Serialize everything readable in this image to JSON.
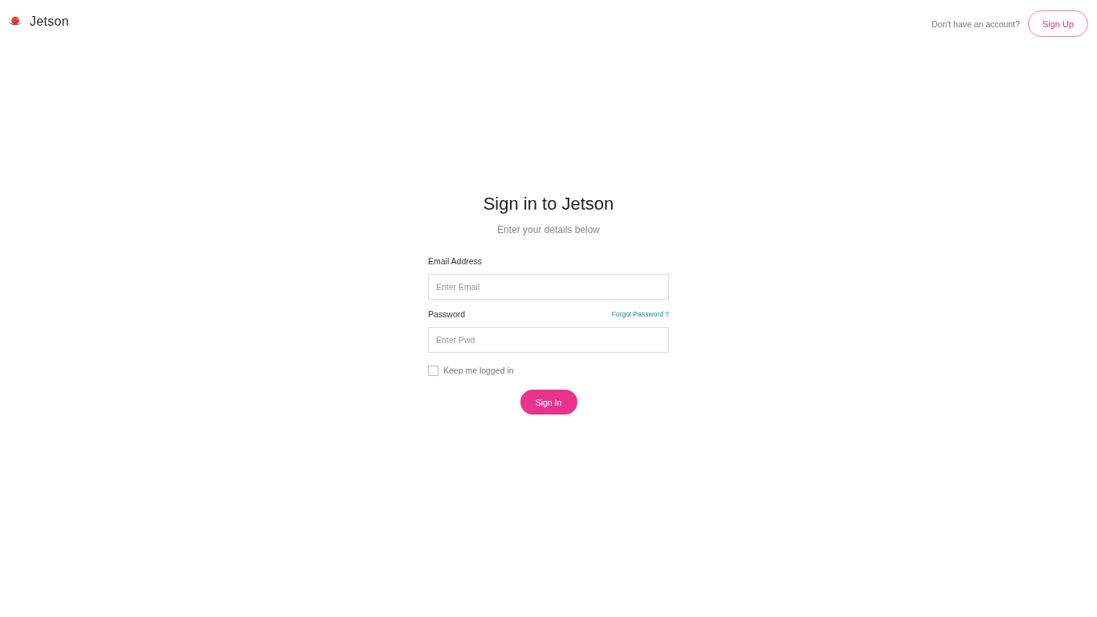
{
  "header": {
    "brand": "Jetson",
    "prompt": "Don't have an account?",
    "signup_button": "Sign Up"
  },
  "form": {
    "title": "Sign in to Jetson",
    "subtitle": "Enter your details below",
    "fields": [
      {
        "label": "Email Address",
        "placeholder": "Enter Email"
      },
      {
        "label": "Password",
        "placeholder": "Enter Pwd",
        "link": "Forgot Password ?"
      }
    ],
    "remember": {
      "label": "Keep me logged in",
      "checked": false
    },
    "submit_button": "Sign In"
  }
}
